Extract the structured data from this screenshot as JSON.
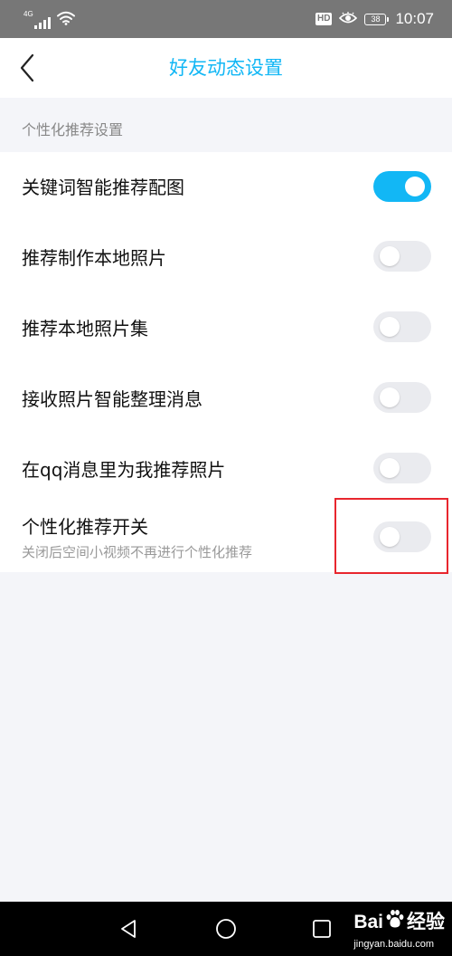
{
  "status_bar": {
    "network": "4G",
    "hd_badge": "HD",
    "battery": "38",
    "time": "10:07",
    "icons": [
      "signal-icon",
      "wifi-icon",
      "eye-icon",
      "battery-icon"
    ]
  },
  "header": {
    "title": "好友动态设置",
    "back_icon": "chevron-left-icon"
  },
  "section": {
    "title": "个性化推荐设置"
  },
  "settings": [
    {
      "label": "关键词智能推荐配图",
      "on": true
    },
    {
      "label": "推荐制作本地照片",
      "on": false
    },
    {
      "label": "推荐本地照片集",
      "on": false
    },
    {
      "label": "接收照片智能整理消息",
      "on": false
    },
    {
      "label": "在qq消息里为我推荐照片",
      "on": false
    },
    {
      "label": "个性化推荐开关",
      "subtitle": "关闭后空间小视频不再进行个性化推荐",
      "on": false
    }
  ],
  "navigation": {
    "icons": [
      "back-triangle-icon",
      "home-circle-icon",
      "recents-square-icon"
    ]
  },
  "watermark": {
    "brand": "Bai",
    "brand_suffix": "经验",
    "url": "jingyan.baidu.com"
  },
  "colors": {
    "accent": "#12b7f5",
    "toggle_off": "#eaebef",
    "highlight": "#e8262e",
    "status_bar": "#777777",
    "background": "#f4f5f9"
  }
}
